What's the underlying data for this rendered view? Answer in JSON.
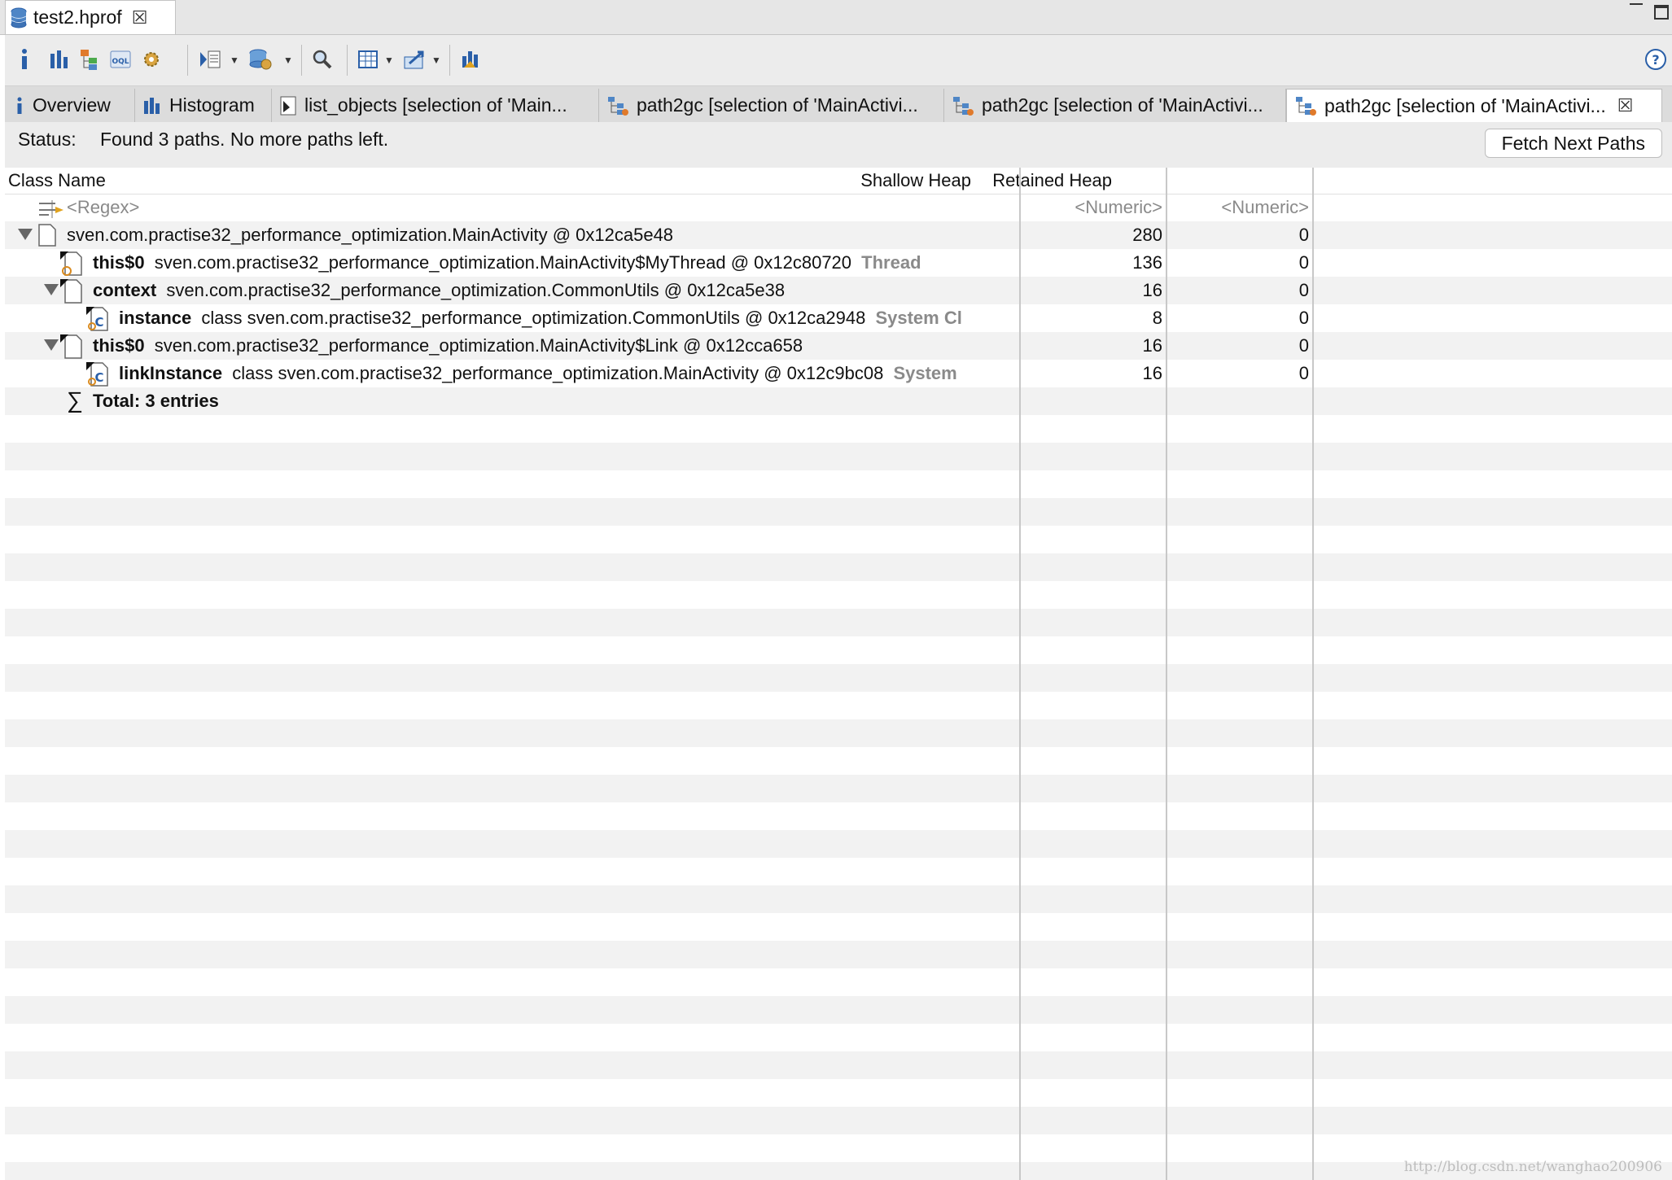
{
  "editor": {
    "tab_title": "test2.hprof"
  },
  "view_tabs": [
    {
      "label": "Overview"
    },
    {
      "label": "Histogram"
    },
    {
      "label": "list_objects [selection of 'Main..."
    },
    {
      "label": "path2gc [selection of 'MainActivi..."
    },
    {
      "label": "path2gc [selection of 'MainActivi..."
    },
    {
      "label": "path2gc [selection of 'MainActivi..."
    }
  ],
  "status": {
    "label": "Status:",
    "message": "Found 3 paths. No more paths left.",
    "fetch_button": "Fetch Next Paths"
  },
  "table": {
    "headers": [
      "Class Name",
      "Shallow Heap",
      "Retained Heap"
    ],
    "filter": {
      "class": "<Regex>",
      "shallow": "<Numeric>",
      "retained": "<Numeric>"
    },
    "rows": [
      {
        "field": "",
        "name": "sven.com.practise32_performance_optimization.MainActivity @ 0x12ca5e48",
        "tag": "",
        "shallow": "280",
        "retained": "0"
      },
      {
        "field": "this$0",
        "name": "sven.com.practise32_performance_optimization.MainActivity$MyThread @ 0x12c80720",
        "tag": "Thread",
        "shallow": "136",
        "retained": "0"
      },
      {
        "field": "context",
        "name": "sven.com.practise32_performance_optimization.CommonUtils @ 0x12ca5e38",
        "tag": "",
        "shallow": "16",
        "retained": "0"
      },
      {
        "field": "instance",
        "name": "class sven.com.practise32_performance_optimization.CommonUtils @ 0x12ca2948",
        "tag": "System Cl",
        "shallow": "8",
        "retained": "0"
      },
      {
        "field": "this$0",
        "name": "sven.com.practise32_performance_optimization.MainActivity$Link @ 0x12cca658",
        "tag": "",
        "shallow": "16",
        "retained": "0"
      },
      {
        "field": "linkInstance",
        "name": "class sven.com.practise32_performance_optimization.MainActivity @ 0x12c9bc08",
        "tag": "System",
        "shallow": "16",
        "retained": "0"
      }
    ],
    "total": "Total: 3 entries"
  },
  "watermark": "http://blog.csdn.net/wanghao200906",
  "colors": {
    "toolbar_bg": "#ececec",
    "tab_bg": "#dcdcdc",
    "row_alt": "#f2f2f2",
    "icon_blue": "#2a5fa8",
    "icon_orange": "#d98a1e"
  }
}
